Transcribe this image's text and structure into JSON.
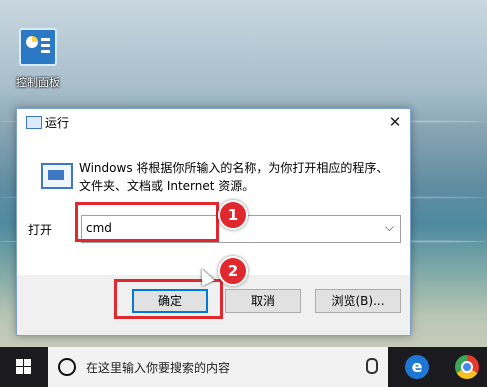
{
  "desktop": {
    "control_panel_label": "控制面板"
  },
  "run_dialog": {
    "title": "运行",
    "close_glyph": "✕",
    "description_line1": "Windows 将根据你所输入的名称，为你打开相应的程序、",
    "description_line2": "文件夹、文档或 Internet 资源。",
    "open_label": "打开",
    "input_value": "cmd",
    "dropdown_glyph": "⌵",
    "ok_label": "确定",
    "cancel_label": "取消",
    "browse_label": "浏览(B)..."
  },
  "annotations": {
    "step1": "1",
    "step2": "2",
    "highlight_color": "#e0292f"
  },
  "taskbar": {
    "search_placeholder": "在这里输入你要搜索的内容",
    "edge_glyph": "e",
    "icons": [
      "windows-start-icon",
      "cortana-icon",
      "microphone-icon",
      "edge-icon",
      "chrome-icon"
    ]
  },
  "colors": {
    "accent": "#0078d7",
    "taskbar": "#1b1b1f"
  }
}
